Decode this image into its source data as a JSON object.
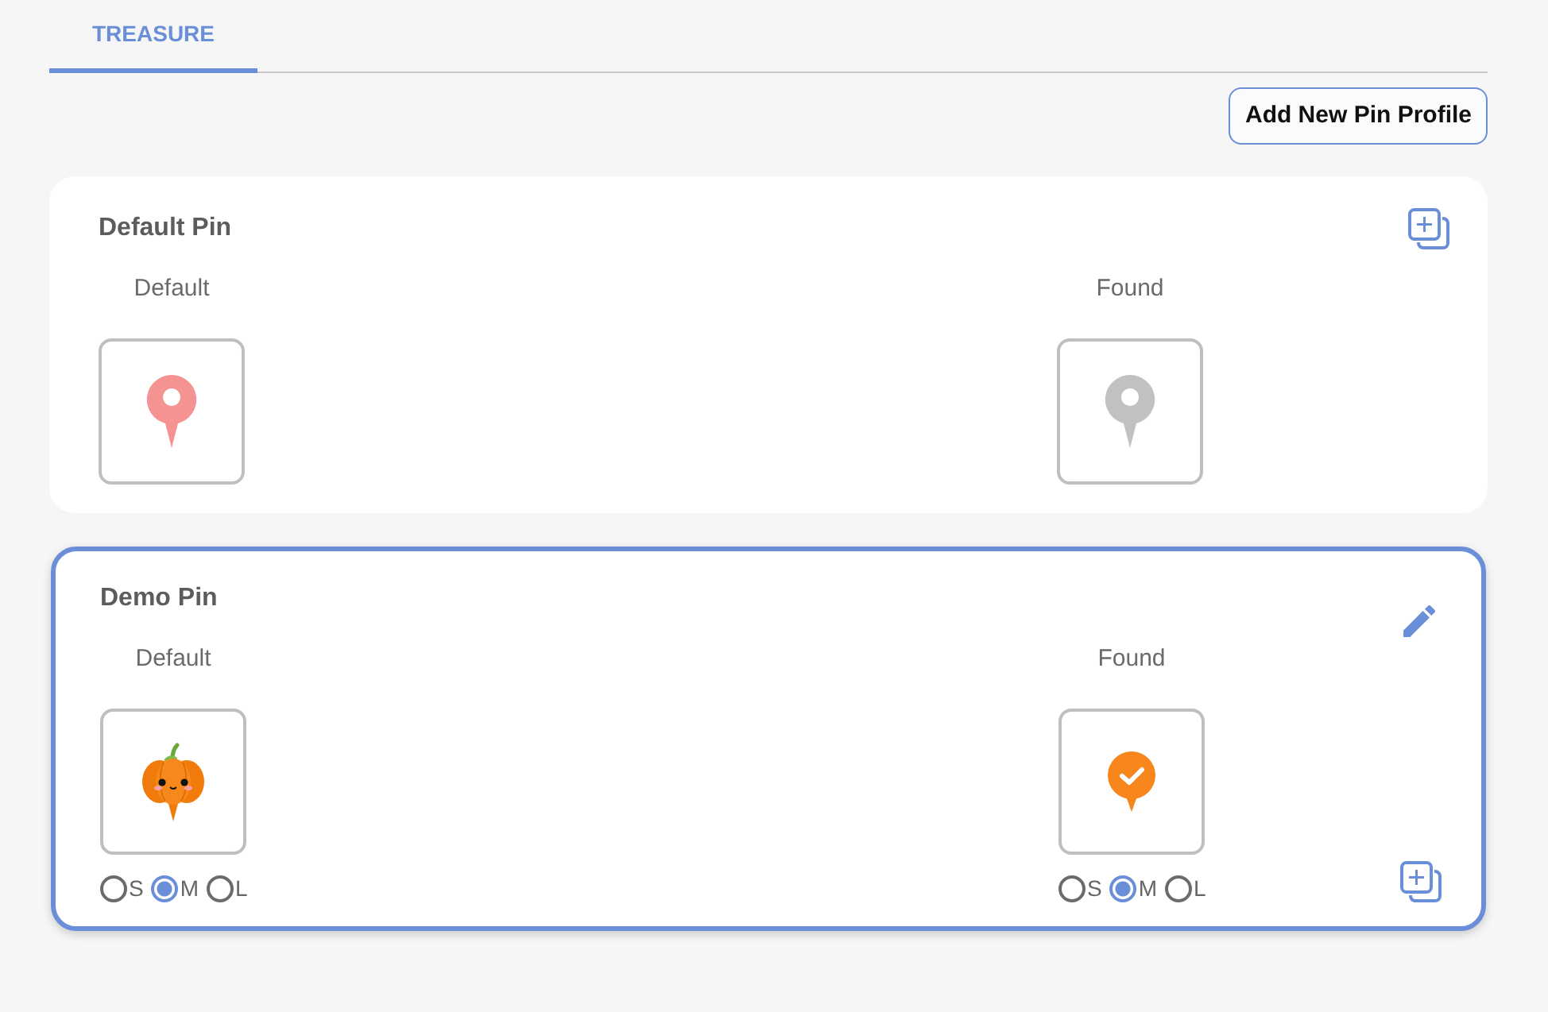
{
  "tabs": [
    {
      "label": "TREASURE",
      "selected": true
    }
  ],
  "add_button": {
    "label": "Add New Pin Profile"
  },
  "profiles": [
    {
      "title": "Default Pin",
      "selected": false,
      "slots": [
        {
          "label": "Default",
          "pin": {
            "kind": "plain",
            "color": "#f59393"
          }
        },
        {
          "label": "Found",
          "pin": {
            "kind": "plain",
            "color": "#c2c0c0"
          }
        }
      ]
    },
    {
      "title": "Demo Pin",
      "selected": true,
      "slots": [
        {
          "label": "Default",
          "pin": {
            "kind": "pumpkin"
          },
          "sizes": [
            {
              "label": "S",
              "selected": false
            },
            {
              "label": "M",
              "selected": true
            },
            {
              "label": "L",
              "selected": false
            }
          ]
        },
        {
          "label": "Found",
          "pin": {
            "kind": "check"
          },
          "sizes": [
            {
              "label": "S",
              "selected": false
            },
            {
              "label": "M",
              "selected": true
            },
            {
              "label": "L",
              "selected": false
            }
          ]
        }
      ]
    }
  ]
}
